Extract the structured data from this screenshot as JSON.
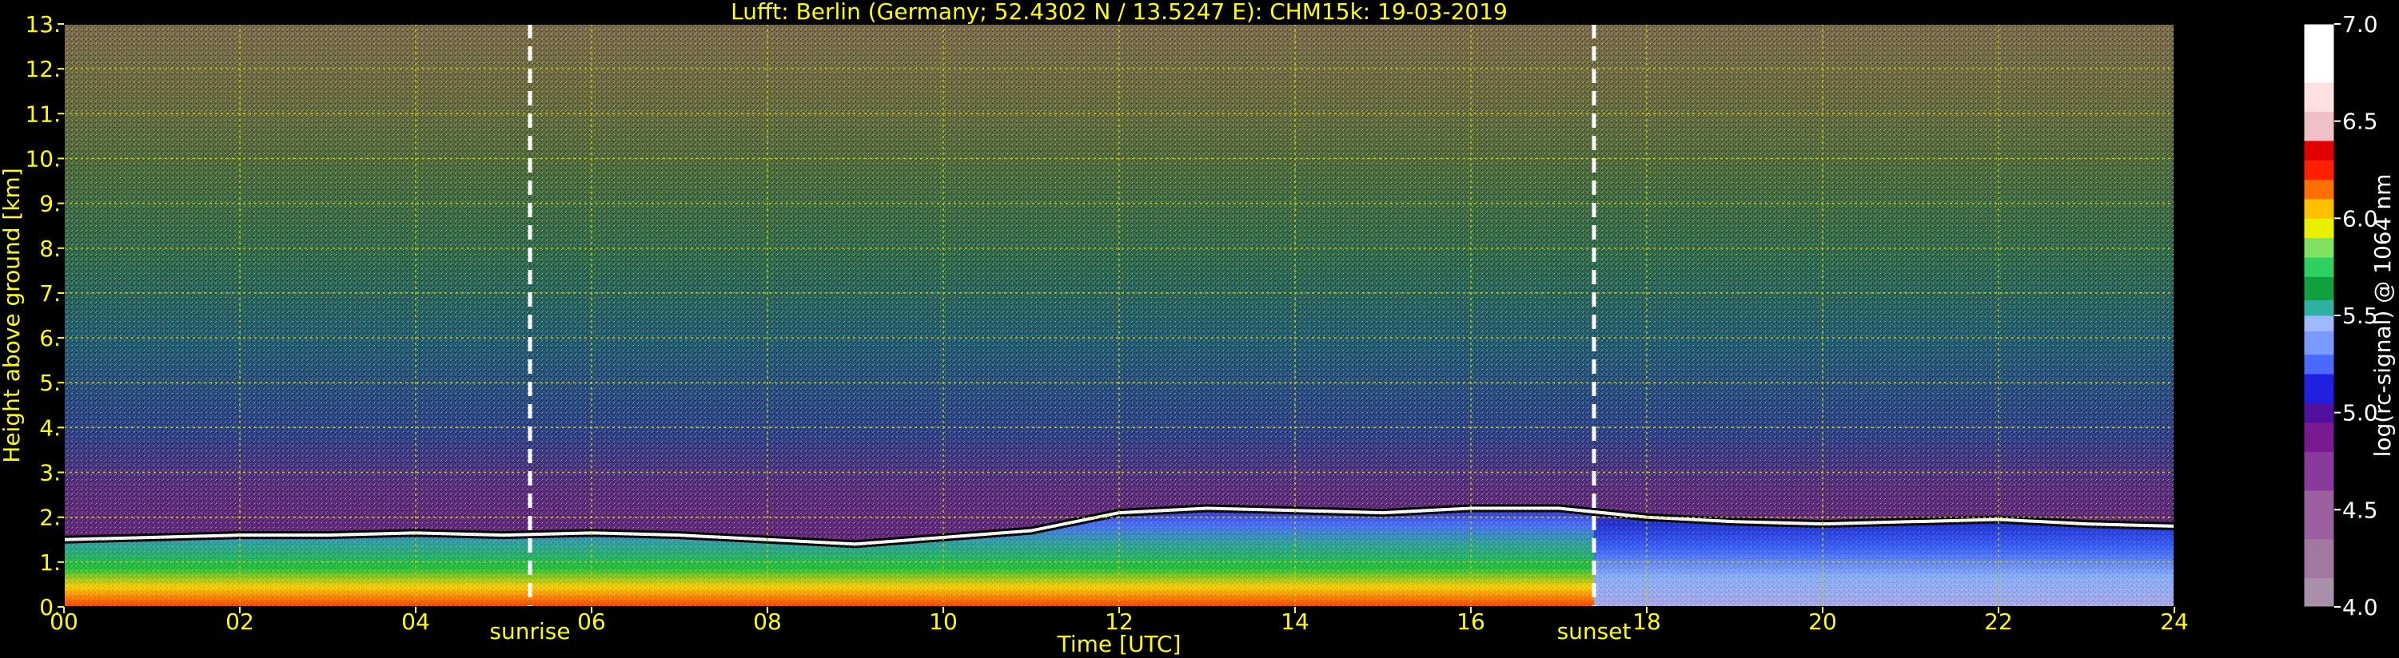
{
  "chart_data": {
    "type": "heatmap",
    "title": "Lufft: Berlin (Germany; 52.4302 N / 13.5247 E):    CHM15k: 19-03-2019",
    "xlabel": "Time [UTC]",
    "ylabel": "Height above ground [km]",
    "xlim": [
      0,
      24
    ],
    "ylim": [
      0,
      13
    ],
    "x_ticks": [
      "00",
      "02",
      "04",
      "06",
      "08",
      "10",
      "12",
      "14",
      "16",
      "18",
      "20",
      "22",
      "24"
    ],
    "y_ticks": [
      "0.",
      "1.",
      "2.",
      "3.",
      "4.",
      "5.",
      "6.",
      "7.",
      "8.",
      "9.",
      "10.",
      "11.",
      "12.",
      "13."
    ],
    "grid": true,
    "annotations": [
      {
        "label": "sunrise",
        "x": 5.3
      },
      {
        "label": "sunset",
        "x": 17.4
      }
    ],
    "colorbar": {
      "label": "log(rc-signal) @ 1064 nm",
      "range": [
        4.0,
        7.0
      ],
      "ticks": [
        "4.0",
        "4.5",
        "5.0",
        "5.5",
        "6.0",
        "6.5",
        "7.0"
      ]
    },
    "boundary_layer_top_km": [
      [
        0,
        1.5
      ],
      [
        1,
        1.55
      ],
      [
        2,
        1.6
      ],
      [
        3,
        1.6
      ],
      [
        4,
        1.65
      ],
      [
        5,
        1.6
      ],
      [
        6,
        1.65
      ],
      [
        7,
        1.6
      ],
      [
        8,
        1.5
      ],
      [
        9,
        1.4
      ],
      [
        10,
        1.55
      ],
      [
        11,
        1.7
      ],
      [
        12,
        2.1
      ],
      [
        13,
        2.2
      ],
      [
        14,
        2.15
      ],
      [
        15,
        2.1
      ],
      [
        16,
        2.2
      ],
      [
        17,
        2.2
      ],
      [
        18,
        2.0
      ],
      [
        19,
        1.9
      ],
      [
        20,
        1.85
      ],
      [
        21,
        1.9
      ],
      [
        22,
        1.95
      ],
      [
        23,
        1.85
      ],
      [
        24,
        1.8
      ]
    ],
    "colors": {
      "axis_text": "#ffff00",
      "grid": "#c8c800",
      "annotation_line": "#ffffff",
      "colorbar_text": "#ffffff"
    }
  }
}
